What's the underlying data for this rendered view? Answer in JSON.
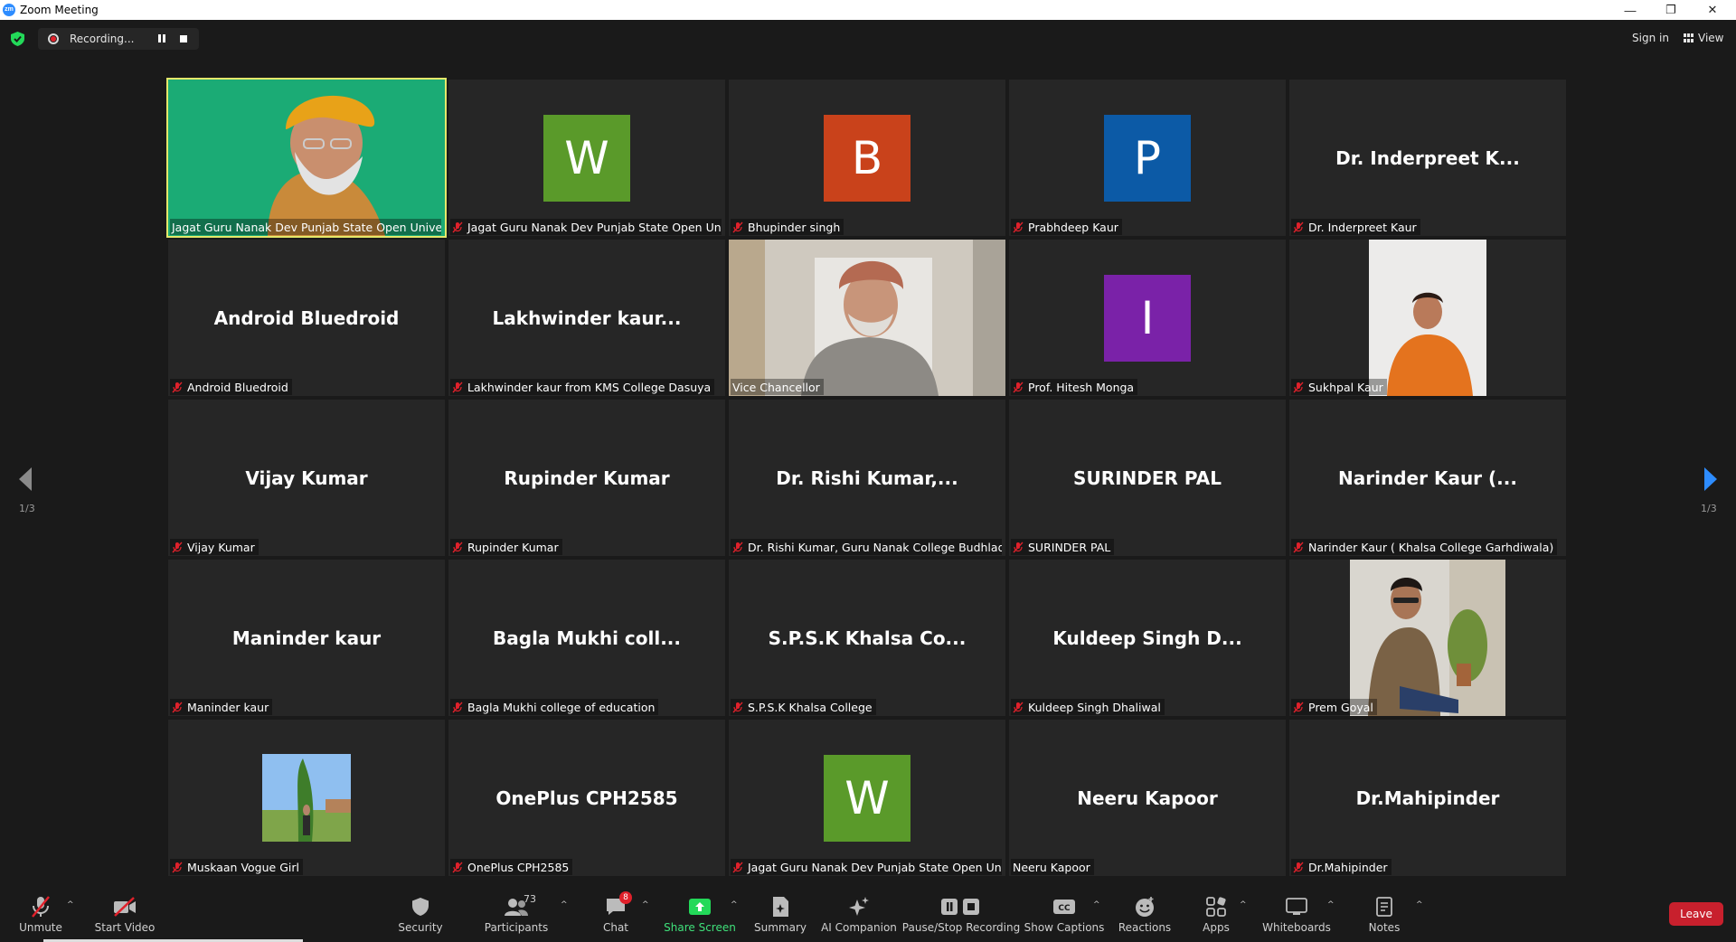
{
  "window": {
    "title": "Zoom Meeting",
    "logo_text": "zm",
    "minimize": "—",
    "maximize": "❐",
    "close": "✕"
  },
  "topbar": {
    "recording_label": "Recording...",
    "sign_in": "Sign in",
    "view": "View"
  },
  "pager": {
    "left_count": "1/3",
    "right_count": "1/3"
  },
  "tiles": [
    {
      "label": "Jagat Guru Nanak Dev Punjab State Open Univer...",
      "type": "video",
      "muted": false,
      "active": true
    },
    {
      "label": "Jagat Guru Nanak Dev Punjab State Open Uni...",
      "type": "avatar",
      "avatar_letter": "W",
      "avatar_color": "#5a9a2a",
      "muted": true
    },
    {
      "label": "Bhupinder singh",
      "type": "avatar",
      "avatar_letter": "B",
      "avatar_color": "#c9421b",
      "muted": true
    },
    {
      "label": "Prabhdeep Kaur",
      "type": "avatar",
      "avatar_letter": "P",
      "avatar_color": "#0c5aa6",
      "muted": true
    },
    {
      "label": "Dr. Inderpreet Kaur",
      "type": "name",
      "center_name": "Dr. Inderpreet K...",
      "muted": true
    },
    {
      "label": "Android Bluedroid",
      "type": "name",
      "center_name": "Android Bluedroid",
      "muted": true
    },
    {
      "label": "Lakhwinder kaur from KMS College Dasuya",
      "type": "name",
      "center_name": "Lakhwinder  kaur...",
      "muted": true
    },
    {
      "label": "Vice Chancellor",
      "type": "video",
      "muted": false
    },
    {
      "label": "Prof.  Hitesh Monga",
      "type": "avatar",
      "avatar_letter": "I",
      "avatar_color": "#7a22a8",
      "muted": true
    },
    {
      "label": "Sukhpal Kaur",
      "type": "video",
      "muted": true
    },
    {
      "label": "Vijay Kumar",
      "type": "name",
      "center_name": "Vijay Kumar",
      "muted": true
    },
    {
      "label": "Rupinder Kumar",
      "type": "name",
      "center_name": "Rupinder Kumar",
      "muted": true
    },
    {
      "label": "Dr. Rishi Kumar, Guru Nanak College Budhlada",
      "type": "name",
      "center_name": "Dr.  Rishi  Kumar,...",
      "muted": true
    },
    {
      "label": "SURINDER PAL",
      "type": "name",
      "center_name": "SURINDER PAL",
      "muted": true
    },
    {
      "label": "Narinder Kaur ( Khalsa College Garhdiwala)",
      "type": "name",
      "center_name": "Narinder  Kaur  (...",
      "muted": true
    },
    {
      "label": "Maninder kaur",
      "type": "name",
      "center_name": "Maninder kaur",
      "muted": true
    },
    {
      "label": "Bagla Mukhi college of education",
      "type": "name",
      "center_name": "Bagla  Mukhi  coll...",
      "muted": true
    },
    {
      "label": "S.P.S.K Khalsa College",
      "type": "name",
      "center_name": "S.P.S.K  Khalsa  Co...",
      "muted": true
    },
    {
      "label": "Kuldeep Singh Dhaliwal",
      "type": "name",
      "center_name": "Kuldeep  Singh  D...",
      "muted": true
    },
    {
      "label": "Prem Goyal",
      "type": "video",
      "muted": true
    },
    {
      "label": "Muskaan Vogue Girl",
      "type": "video",
      "muted": true
    },
    {
      "label": "OnePlus CPH2585",
      "type": "name",
      "center_name": "OnePlus CPH2585",
      "muted": true
    },
    {
      "label": "Jagat Guru Nanak Dev Punjab State Open Uni...",
      "type": "avatar",
      "avatar_letter": "W",
      "avatar_color": "#5a9a2a",
      "muted": true
    },
    {
      "label": "Neeru Kapoor",
      "type": "name",
      "center_name": "Neeru Kapoor",
      "muted": false
    },
    {
      "label": "Dr.Mahipinder",
      "type": "name",
      "center_name": "Dr.Mahipinder",
      "muted": true
    }
  ],
  "toolbar": {
    "unmute": "Unmute",
    "start_video": "Start Video",
    "security": "Security",
    "participants": "Participants",
    "participants_count": "73",
    "chat": "Chat",
    "chat_badge": "8",
    "share_screen": "Share Screen",
    "summary": "Summary",
    "ai_companion": "AI Companion",
    "pause_stop_recording": "Pause/Stop Recording",
    "show_captions": "Show Captions",
    "reactions": "Reactions",
    "apps": "Apps",
    "whiteboards": "Whiteboards",
    "notes": "Notes",
    "leave": "Leave",
    "caret": "^"
  }
}
